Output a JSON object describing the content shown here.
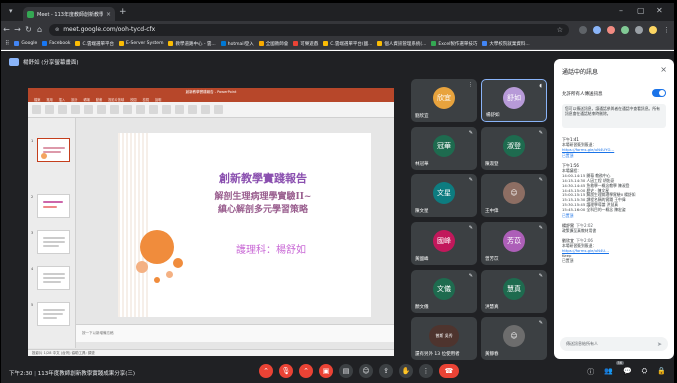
{
  "browser": {
    "tab_title": "Meet - 113年度教師創新教學實",
    "url": "meet.google.com/ooh-tycd-cfx",
    "bookmarks": [
      "Google",
      "Facebook",
      "C.雲端選單平台",
      "E-Server System",
      "教學道路中心 - 雲...",
      "hotmail登入",
      "全國教師會",
      "可樂遊戲",
      "C.雲端選單平台(國...",
      "個人資訊管理系統(...",
      "Excel製作選單技巧",
      "大學校院就業資料..."
    ]
  },
  "meet": {
    "presenting_label": "楊舒如 (分享螢幕畫面)",
    "meeting_time": "下午2:30",
    "meeting_title": "113年度教師創新教學實踐成果分享(三)",
    "participant_count": "56",
    "participants": [
      {
        "initials": "欣宜",
        "name": "劉欣宜",
        "color": "#e8a33d",
        "speaking": false
      },
      {
        "initials": "舒如",
        "name": "楊舒如",
        "color": "#b79ad8",
        "speaking": true
      },
      {
        "initials": "冠華",
        "name": "林冠華",
        "color": "#1e6b4f",
        "speaking": false
      },
      {
        "initials": "淑登",
        "name": "陳淑登",
        "color": "#1e6b4f",
        "speaking": false
      },
      {
        "initials": "文星",
        "name": "陳文星",
        "color": "#0d7c80",
        "speaking": false
      },
      {
        "initials": "",
        "name": "王中偉",
        "color": "#8d6e63",
        "speaking": false
      },
      {
        "initials": "國峰",
        "name": "黃國峰",
        "color": "#c2185b",
        "speaking": false
      },
      {
        "initials": "芳苡",
        "name": "曾芳苡",
        "color": "#ad5fb8",
        "speaking": false
      },
      {
        "initials": "文儀",
        "name": "顏文儀",
        "color": "#1e6b4f",
        "speaking": false
      },
      {
        "initials": "慧真",
        "name": "洪慧真",
        "color": "#1e6b4f",
        "speaking": false
      },
      {
        "initials": "曾斯 吳秀",
        "name": "還有另外 13 位使用者",
        "color": "#4e342e",
        "speaking": false
      },
      {
        "initials": "",
        "name": "黃靜春",
        "color": "#6d6d6d",
        "speaking": false
      }
    ]
  },
  "ppt": {
    "window_title": "創新教學實踐報告 - PowerPoint",
    "menu": [
      "檔案",
      "常用",
      "插入",
      "設計",
      "轉場",
      "動畫",
      "投影片放映",
      "校閱",
      "檢視",
      "說明"
    ],
    "slide_title": "創新教學實踐報告",
    "slide_sub1": "解剖生理病理學實驗II~",
    "slide_sub2": "縝心解剖多元學習策略",
    "slide_author": "護理科：楊舒如",
    "notes_placeholder": "按一下以新增備忘稿",
    "status_text": "投影片 1/28  中文 (台灣)  協助工具: 調查"
  },
  "chat": {
    "title": "通話中的訊息",
    "toggle_label": "允許所有人傳送訊息",
    "notice": "您可以傳送訊息，讓通話參與者在通話中查看訊息。所有訊息會在通話結束時刪除。",
    "messages": [
      {
        "time": "下午1:41",
        "sender": "",
        "lines": [
          "本場研習簽到簽退：",
          "https://forms.gle/uN4UYG…"
        ],
        "pinned": "已置頂"
      },
      {
        "time": "下午1:56",
        "sender": "",
        "lines": [
          "本場議程：",
          "14:00-14:15  開幕 教務中心",
          "14:15-14:30  人因工程 胡佑豪",
          "14:30-14:45  急救學一概念教學  陳淑登",
          "14:45-15:00  歷史  ‧ 陳文星",
          "15:00-15:15  解剖生理病理學實驗II 楊舒如",
          "15:15-15:30  課程名稱的實踐  王中偉",
          "15:30-15:45  護理學導論  洪慧真",
          "15:45-16:00  全科目的一概念 陳宏姿"
        ],
        "pinned": "已置頂"
      },
      {
        "time": "下午2:02",
        "sender": "楊舒實",
        "lines": [
          "政策擴至真教材用書"
        ],
        "pinned": ""
      },
      {
        "time": "下午2:06",
        "sender": "劉欣宜",
        "lines": [
          "本場研習簽到簽退：",
          "https://forms.gle/uN4U…",
          "Keep",
          "已置頂"
        ],
        "pinned": ""
      }
    ],
    "input_placeholder": "傳送訊息給所有人"
  }
}
